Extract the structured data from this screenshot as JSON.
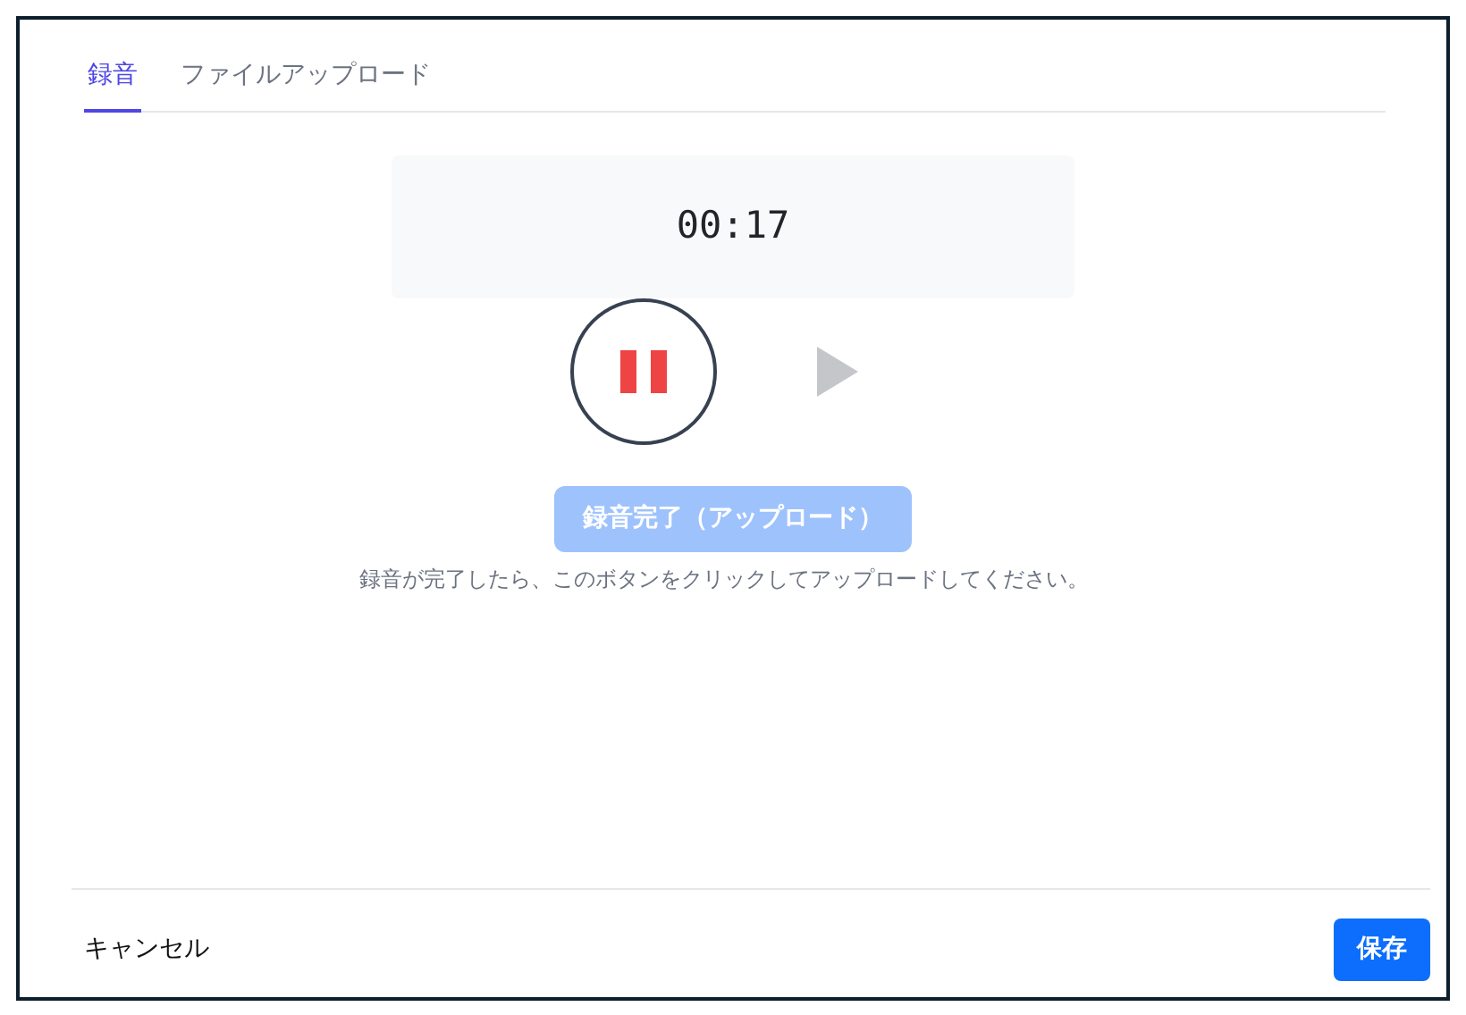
{
  "tabs": [
    {
      "label": "録音",
      "selected": true
    },
    {
      "label": "ファイルアップロード",
      "selected": false
    }
  ],
  "timer": "00:17",
  "recorder": {
    "recording": true,
    "play_disabled": true
  },
  "upload_button": {
    "label": "録音完了（アップロード）",
    "disabled": true
  },
  "hint": "録音が完了したら、このボタンをクリックしてアップロードしてください。",
  "footer": {
    "cancel": "キャンセル",
    "save": "保存"
  }
}
